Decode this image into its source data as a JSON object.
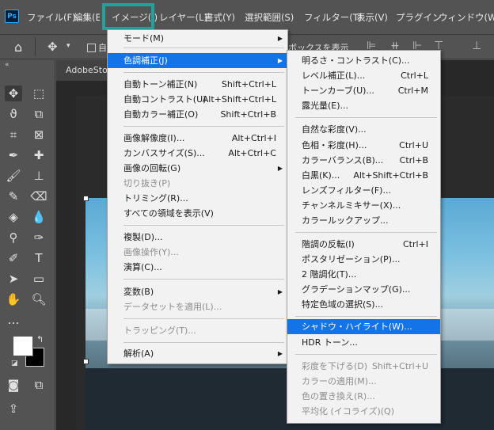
{
  "menubar": {
    "app_logo": "Ps",
    "items": [
      "ファイル(F)",
      "編集(E)",
      "イメージ(I)",
      "レイヤー(L)",
      "書式(Y)",
      "選択範囲(S)",
      "フィルター(T)",
      "表示(V)",
      "プラグイン",
      "ウィンドウ(W)"
    ]
  },
  "optbar": {
    "auto_select_label": "自",
    "show_transform_partial": "ボックスを表示"
  },
  "document": {
    "tab_label": "AdobeSto"
  },
  "image_menu": {
    "items": [
      {
        "label": "モード(M)",
        "shortcut": "",
        "submenu": true,
        "disabled": false
      },
      {
        "label": "色調補正(J)",
        "shortcut": "",
        "submenu": true,
        "disabled": false,
        "highlighted": true
      },
      {
        "label": "自動トーン補正(N)",
        "shortcut": "Shift+Ctrl+L",
        "submenu": false,
        "disabled": false
      },
      {
        "label": "自動コントラスト(U)",
        "shortcut": "Alt+Shift+Ctrl+L",
        "submenu": false,
        "disabled": false
      },
      {
        "label": "自動カラー補正(O)",
        "shortcut": "Shift+Ctrl+B",
        "submenu": false,
        "disabled": false
      },
      {
        "label": "画像解像度(I)...",
        "shortcut": "Alt+Ctrl+I",
        "submenu": false,
        "disabled": false
      },
      {
        "label": "カンバスサイズ(S)...",
        "shortcut": "Alt+Ctrl+C",
        "submenu": false,
        "disabled": false
      },
      {
        "label": "画像の回転(G)",
        "shortcut": "",
        "submenu": true,
        "disabled": false
      },
      {
        "label": "切り抜き(P)",
        "shortcut": "",
        "submenu": false,
        "disabled": true
      },
      {
        "label": "トリミング(R)...",
        "shortcut": "",
        "submenu": false,
        "disabled": false
      },
      {
        "label": "すべての領域を表示(V)",
        "shortcut": "",
        "submenu": false,
        "disabled": false
      },
      {
        "label": "複製(D)...",
        "shortcut": "",
        "submenu": false,
        "disabled": false
      },
      {
        "label": "画像操作(Y)...",
        "shortcut": "",
        "submenu": false,
        "disabled": true
      },
      {
        "label": "演算(C)...",
        "shortcut": "",
        "submenu": false,
        "disabled": false
      },
      {
        "label": "変数(B)",
        "shortcut": "",
        "submenu": true,
        "disabled": false
      },
      {
        "label": "データセットを適用(L)...",
        "shortcut": "",
        "submenu": false,
        "disabled": true
      },
      {
        "label": "トラッピング(T)...",
        "shortcut": "",
        "submenu": false,
        "disabled": true
      },
      {
        "label": "解析(A)",
        "shortcut": "",
        "submenu": true,
        "disabled": false
      }
    ]
  },
  "adjust_menu": {
    "items": [
      {
        "label": "明るさ・コントラスト(C)...",
        "shortcut": "",
        "disabled": false
      },
      {
        "label": "レベル補正(L)...",
        "shortcut": "Ctrl+L",
        "disabled": false
      },
      {
        "label": "トーンカーブ(U)...",
        "shortcut": "Ctrl+M",
        "disabled": false
      },
      {
        "label": "露光量(E)...",
        "shortcut": "",
        "disabled": false
      },
      {
        "label": "自然な彩度(V)...",
        "shortcut": "",
        "disabled": false
      },
      {
        "label": "色相・彩度(H)...",
        "shortcut": "Ctrl+U",
        "disabled": false
      },
      {
        "label": "カラーバランス(B)...",
        "shortcut": "Ctrl+B",
        "disabled": false
      },
      {
        "label": "白黒(K)...",
        "shortcut": "Alt+Shift+Ctrl+B",
        "disabled": false
      },
      {
        "label": "レンズフィルター(F)...",
        "shortcut": "",
        "disabled": false
      },
      {
        "label": "チャンネルミキサー(X)...",
        "shortcut": "",
        "disabled": false
      },
      {
        "label": "カラールックアップ...",
        "shortcut": "",
        "disabled": false
      },
      {
        "label": "階調の反転(I)",
        "shortcut": "Ctrl+I",
        "disabled": false
      },
      {
        "label": "ポスタリゼーション(P)...",
        "shortcut": "",
        "disabled": false
      },
      {
        "label": "2 階調化(T)...",
        "shortcut": "",
        "disabled": false
      },
      {
        "label": "グラデーションマップ(G)...",
        "shortcut": "",
        "disabled": false
      },
      {
        "label": "特定色域の選択(S)...",
        "shortcut": "",
        "disabled": false
      },
      {
        "label": "シャドウ・ハイライト(W)...",
        "shortcut": "",
        "disabled": false,
        "highlighted": true
      },
      {
        "label": "HDR トーン...",
        "shortcut": "",
        "disabled": false
      },
      {
        "label": "彩度を下げる(D)",
        "shortcut": "Shift+Ctrl+U",
        "disabled": true
      },
      {
        "label": "カラーの適用(M)...",
        "shortcut": "",
        "disabled": true
      },
      {
        "label": "色の置き換え(R)...",
        "shortcut": "",
        "disabled": true
      },
      {
        "label": "平均化 (イコライズ)(Q)",
        "shortcut": "",
        "disabled": true
      }
    ]
  },
  "colors": {
    "highlight": "#1473e6",
    "callout": "#1fa39a",
    "menu_bg": "#f2f2f2",
    "ui_bg": "#535353"
  }
}
